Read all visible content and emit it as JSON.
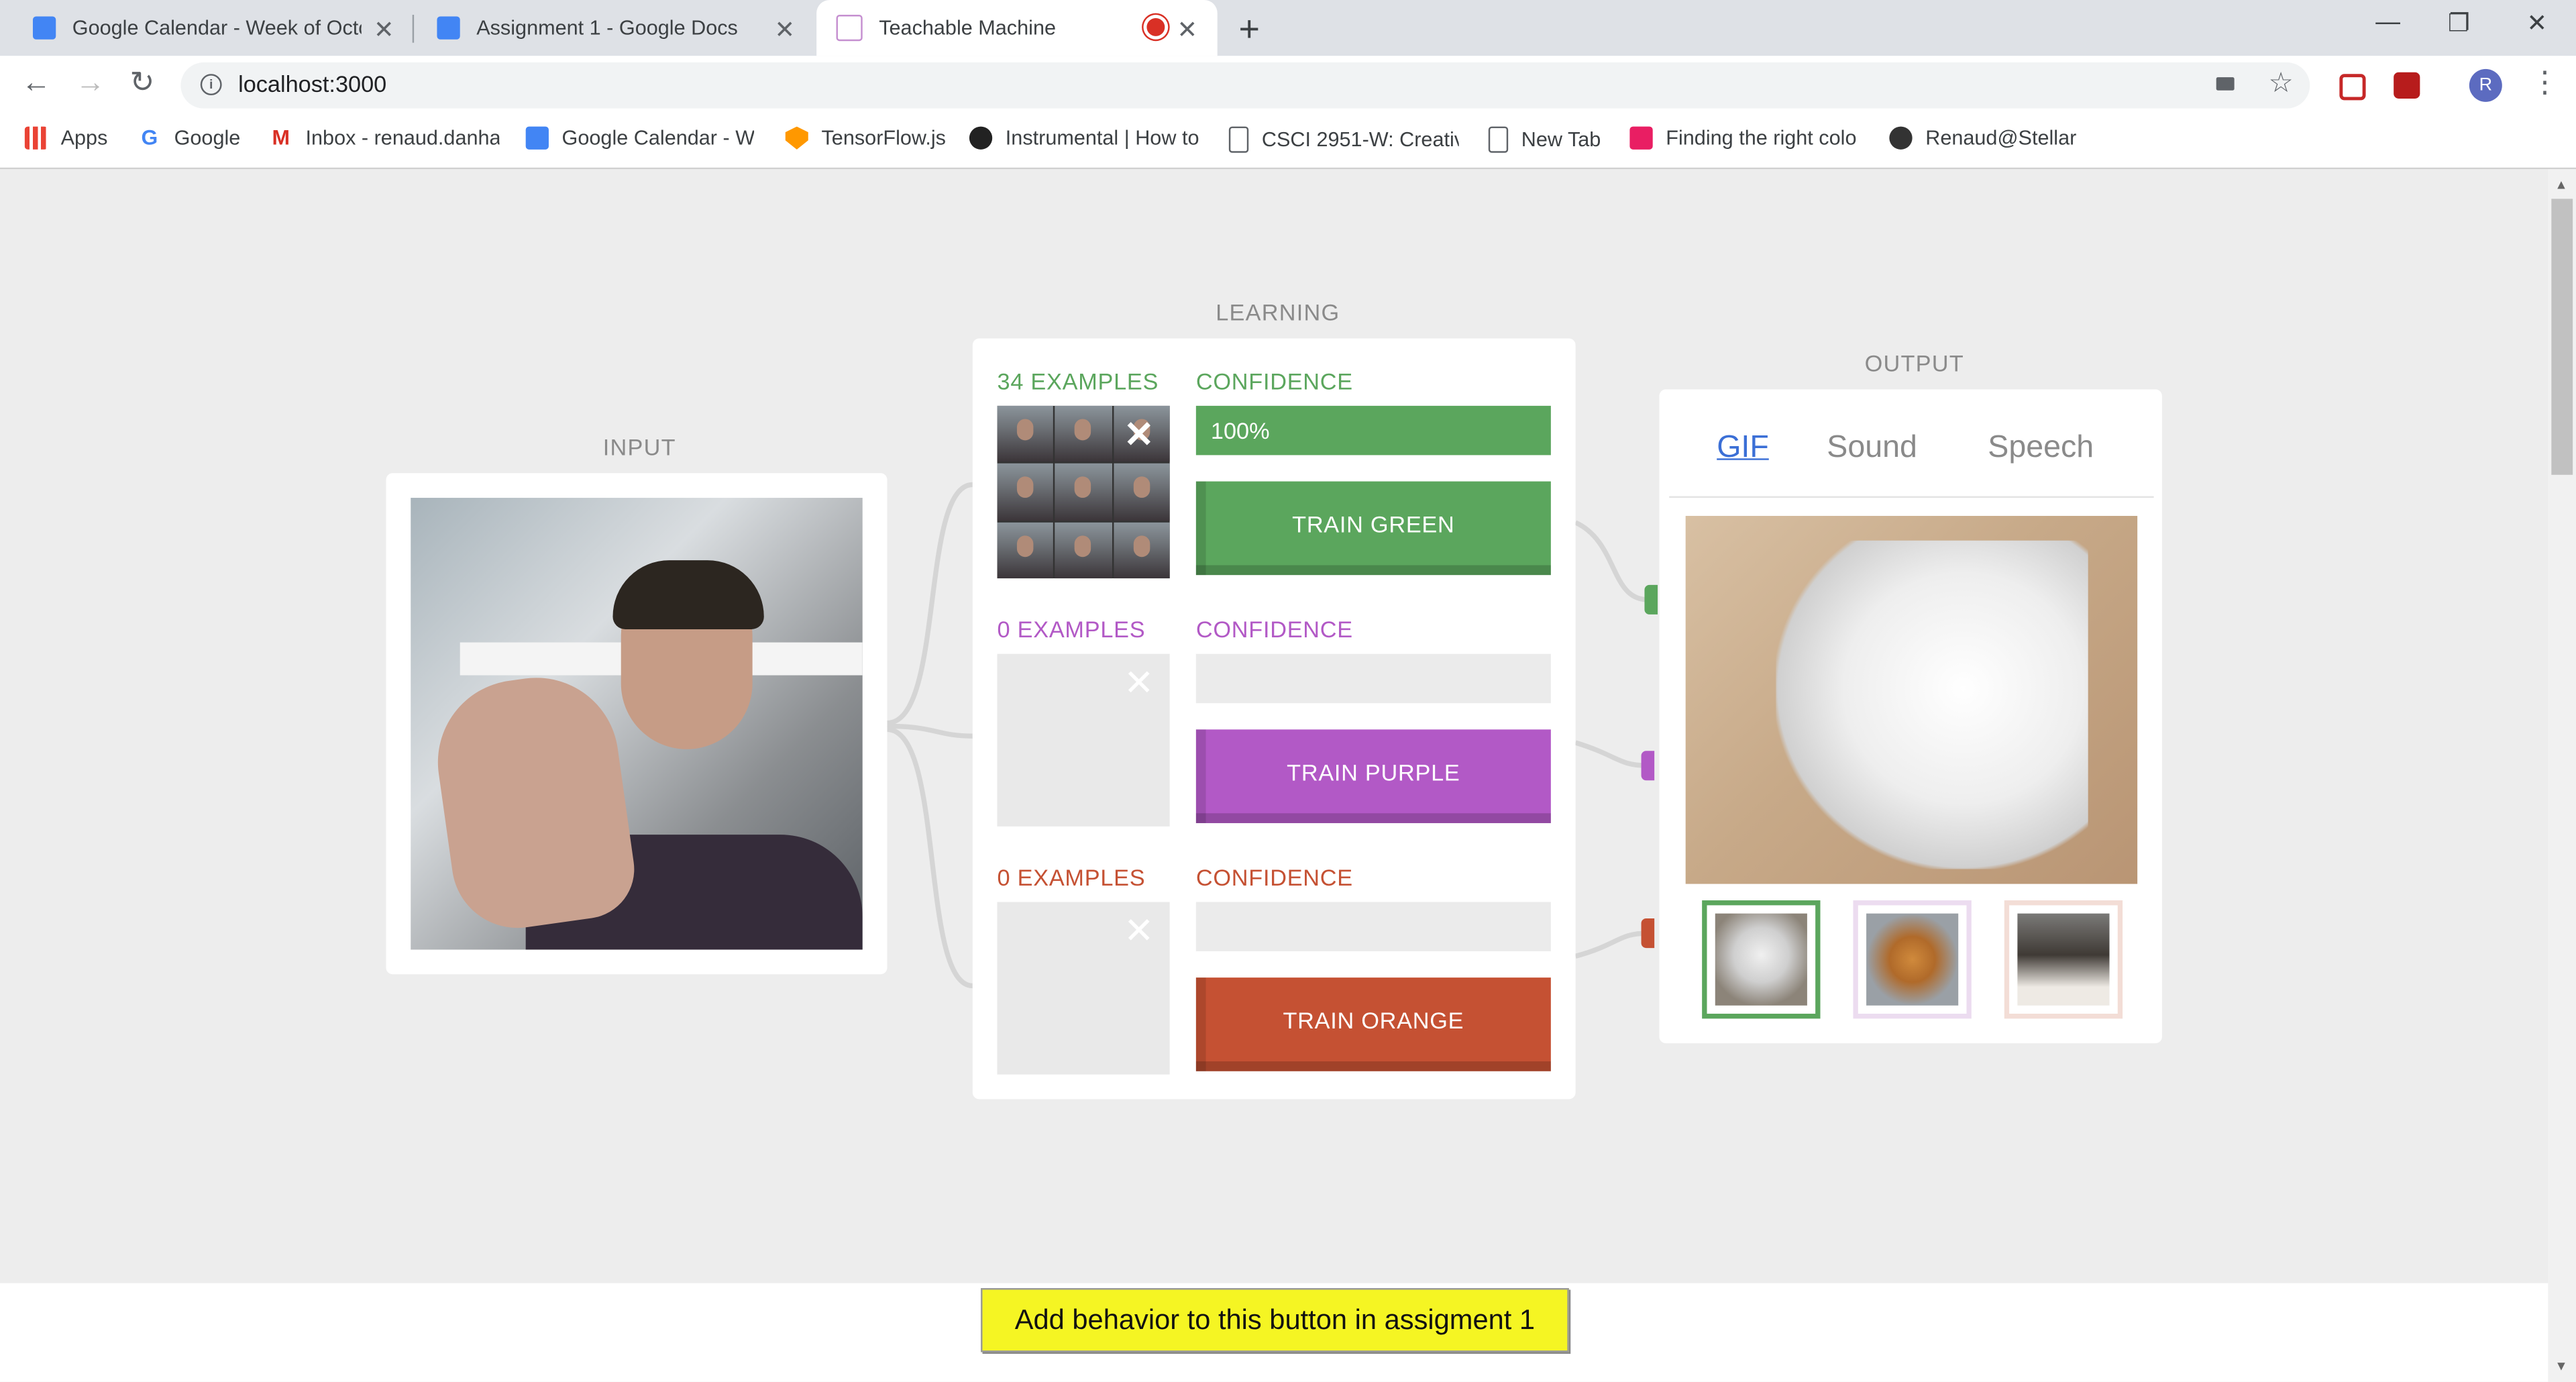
{
  "browser": {
    "tabs": [
      {
        "title": "Google Calendar - Week of Octo",
        "icon": "calendar-icon",
        "color": "#4285f4"
      },
      {
        "title": "Assignment 1 - Google Docs",
        "icon": "docs-icon",
        "color": "#4285f4"
      },
      {
        "title": "Teachable Machine",
        "icon": "page-icon",
        "color": "#ffffff",
        "active": true
      }
    ],
    "url": "localhost:3000",
    "avatar_letter": "R",
    "bookmarks": [
      {
        "label": "Apps",
        "icon": "apps-icon"
      },
      {
        "label": "Google",
        "icon": "google-icon"
      },
      {
        "label": "Inbox - renaud.danha",
        "icon": "gmail-icon"
      },
      {
        "label": "Google Calendar - W",
        "icon": "calendar-icon"
      },
      {
        "label": "TensorFlow.js",
        "icon": "tensorflow-icon"
      },
      {
        "label": "Instrumental | How to",
        "icon": "instrumental-icon"
      },
      {
        "label": "CSCI 2951-W: Creativ",
        "icon": "document-icon"
      },
      {
        "label": "New Tab",
        "icon": "document-icon"
      },
      {
        "label": "Finding the right colo",
        "icon": "invision-icon"
      },
      {
        "label": "Renaud@Stellar",
        "icon": "stellar-icon"
      }
    ]
  },
  "app": {
    "input_label": "INPUT",
    "learning_label": "LEARNING",
    "output_label": "OUTPUT",
    "classes": [
      {
        "name": "green",
        "examples_label": "34 EXAMPLES",
        "confidence_label": "CONFIDENCE",
        "confidence_text": "100%",
        "confidence": 1.0,
        "button": "TRAIN GREEN",
        "color": "#5ba65d"
      },
      {
        "name": "purple",
        "examples_label": "0 EXAMPLES",
        "confidence_label": "CONFIDENCE",
        "confidence_text": "",
        "confidence": 0,
        "button": "TRAIN PURPLE",
        "color": "#b259c6"
      },
      {
        "name": "orange",
        "examples_label": "0 EXAMPLES",
        "confidence_label": "CONFIDENCE",
        "confidence_text": "",
        "confidence": 0,
        "button": "TRAIN ORANGE",
        "color": "#c55133"
      }
    ],
    "output_tabs": [
      "GIF",
      "Sound",
      "Speech"
    ],
    "active_output_tab": "GIF",
    "footer_button": "Add behavior to this button in assigment 1"
  }
}
